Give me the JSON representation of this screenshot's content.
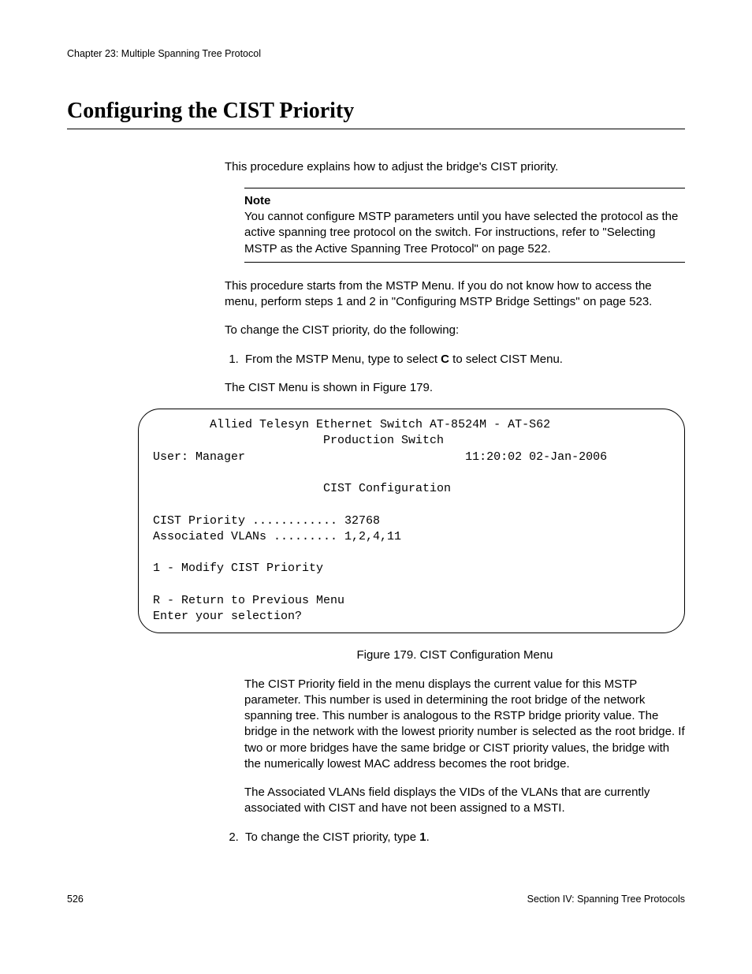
{
  "header": {
    "chapter": "Chapter 23: Multiple Spanning Tree Protocol"
  },
  "title": "Configuring the CIST Priority",
  "intro": "This procedure explains how to adjust the bridge's CIST priority.",
  "note": {
    "label": "Note",
    "body": "You cannot configure MSTP parameters until you have selected the protocol as the active spanning tree protocol on the switch. For instructions, refer to \"Selecting MSTP as the Active Spanning Tree Protocol\" on page 522."
  },
  "para_menu_start": "This procedure starts from the MSTP Menu. If you do not know how to access the menu, perform steps 1 and 2 in \"Configuring MSTP Bridge Settings\" on page 523.",
  "para_todo": "To change the CIST priority, do the following:",
  "step1_prefix": "From the MSTP Menu, type to select ",
  "step1_bold": "C",
  "step1_suffix": " to select CIST Menu.",
  "step1_sub": "The CIST Menu is shown in Figure 179.",
  "terminal": {
    "line1": "        Allied Telesyn Ethernet Switch AT-8524M - AT-S62",
    "line2": "                        Production Switch",
    "line3a": "User: Manager",
    "line3b": "11:20:02 02-Jan-2006",
    "line4": "                        CIST Configuration",
    "line5": "CIST Priority ............ 32768",
    "line6": "Associated VLANs ......... 1,2,4,11",
    "line7": "1 - Modify CIST Priority",
    "line8": "R - Return to Previous Menu",
    "line9": "Enter your selection?"
  },
  "figure_caption": "Figure 179. CIST Configuration Menu",
  "para_cist_field": "The CIST Priority field in the menu displays the current value for this MSTP parameter. This number is used in determining the root bridge of the network spanning tree. This number is analogous to the RSTP bridge priority value. The bridge in the network with the lowest priority number is selected as the root bridge. If two or more bridges have the same bridge or CIST priority values, the bridge with the numerically lowest MAC address becomes the root bridge.",
  "para_assoc_vlans": "The Associated VLANs field displays the VIDs of the VLANs that are currently associated with CIST and have not been assigned to a MSTI.",
  "step2_prefix": "To change the CIST priority, type ",
  "step2_bold": "1",
  "step2_suffix": ".",
  "footer": {
    "page": "526",
    "section": "Section IV: Spanning Tree Protocols"
  }
}
